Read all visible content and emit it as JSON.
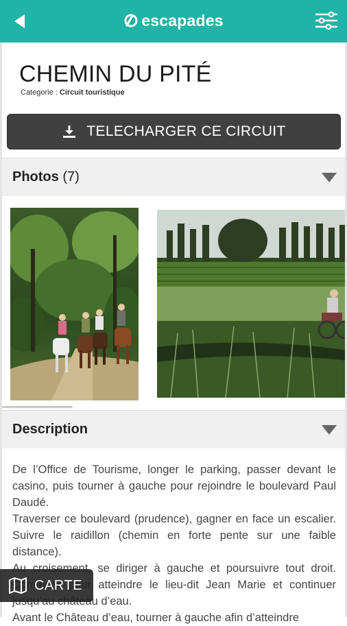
{
  "header": {
    "logo_text": "escapades",
    "back_icon": "back-arrow-icon",
    "filter_icon": "sliders-icon"
  },
  "circuit": {
    "title": "CHEMIN DU PITÉ",
    "category_label": "Categorie :",
    "category_value": "Circuit touristique"
  },
  "download_button": {
    "label": "TELECHARGER CE CIRCUIT",
    "icon": "download-icon"
  },
  "photos_section": {
    "title": "Photos",
    "count": "(7)",
    "icon": "triangle-down-icon"
  },
  "description_section": {
    "title": "Description",
    "icon": "triangle-down-icon"
  },
  "description": [
    "De l’Office de Tourisme, longer le parking, passer devant le casino, puis tourner à gauche pour rejoindre le boulevard Paul Daudé.",
    "Traverser ce boulevard (prudence), gagner en face un escalier. Suivre le raidillon (chemin en forte pente sur une faible distance).",
    "Au croisement, se diriger à gauche et poursuivre tout droit. Continuer pour atteindre le lieu-dit Jean Marie et continuer jusqu’au château d’eau.",
    "Avant le Château d’eau, tourner à gauche afin d’atteindre"
  ],
  "map_button": {
    "label": "CARTE",
    "icon": "map-icon"
  },
  "colors": {
    "brand": "#1fb4a7",
    "button_dark": "#404040"
  }
}
